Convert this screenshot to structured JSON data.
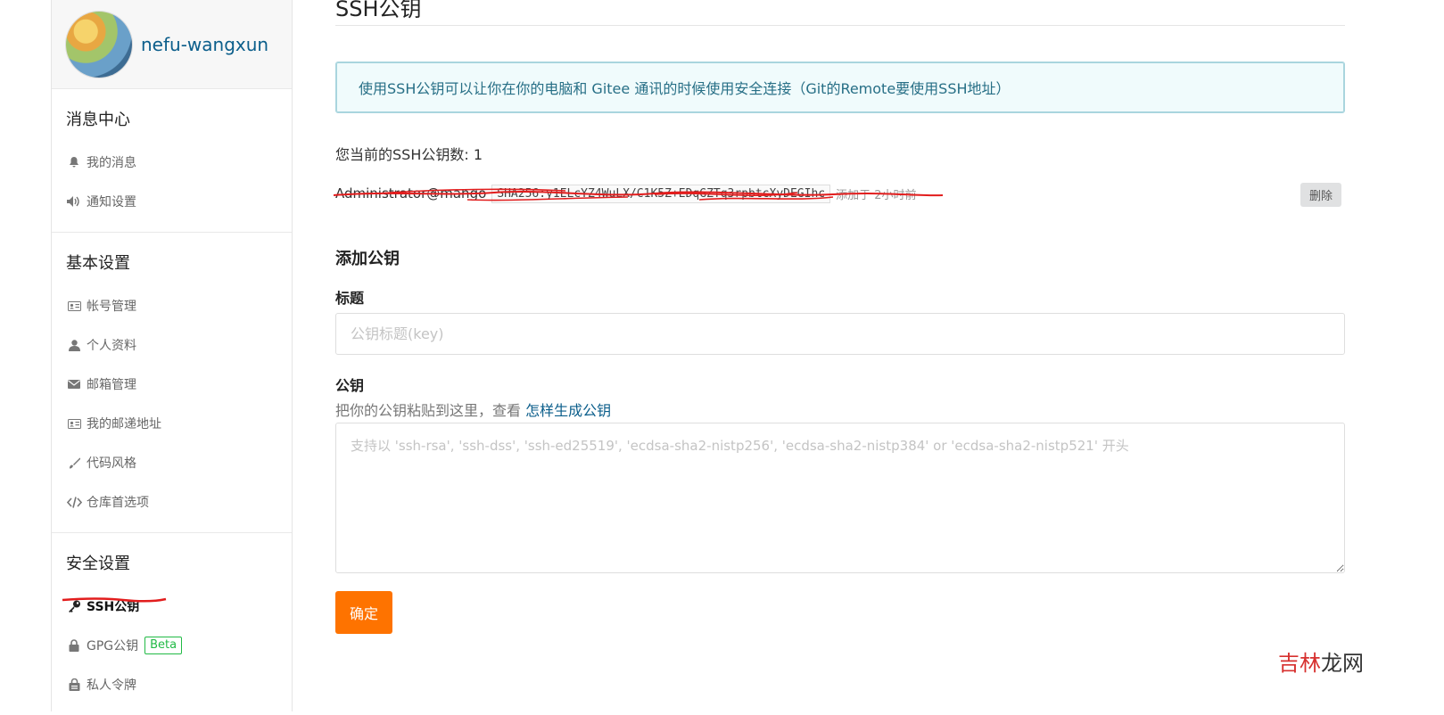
{
  "sidebar": {
    "username": "nefu-wangxun",
    "sections": [
      {
        "title": "消息中心",
        "items": [
          {
            "label": "我的消息"
          },
          {
            "label": "通知设置"
          }
        ]
      },
      {
        "title": "基本设置",
        "items": [
          {
            "label": "帐号管理"
          },
          {
            "label": "个人资料"
          },
          {
            "label": "邮箱管理"
          },
          {
            "label": "我的邮递地址"
          },
          {
            "label": "代码风格"
          },
          {
            "label": "仓库首选项"
          }
        ]
      },
      {
        "title": "安全设置",
        "items": [
          {
            "label": "SSH公钥"
          },
          {
            "label": "GPG公钥",
            "badge": "Beta"
          },
          {
            "label": "私人令牌"
          }
        ]
      }
    ]
  },
  "main": {
    "title": "SSH公钥",
    "info": "使用SSH公钥可以让你在你的电脑和 Gitee 通讯的时候使用安全连接（Git的Remote要使用SSH地址）",
    "count_text": "您当前的SSH公钥数: 1",
    "key": {
      "title": "Administrator@mango",
      "fingerprint": "SHA256:y1ELcYZ4WuLX/C1K5Z+EDqGZTq3rpbtcXyDEGIhc",
      "time": "添加于 2小时前",
      "delete_label": "删除"
    },
    "add_title": "添加公钥",
    "title_label": "标题",
    "title_placeholder": "公钥标题(key)",
    "key_label": "公钥",
    "hint_prefix": "把你的公钥粘贴到这里，查看 ",
    "hint_link": "怎样生成公钥",
    "key_placeholder": "支持以 'ssh-rsa', 'ssh-dss', 'ssh-ed25519', 'ecdsa-sha2-nistp256', 'ecdsa-sha2-nistp384' or 'ecdsa-sha2-nistp521' 开头",
    "submit_label": "确定"
  },
  "watermark": {
    "part1": "吉林",
    "part2": "龙网"
  },
  "colors": {
    "accent": "#fe7300",
    "link": "#0b5e8b",
    "info_bg": "#f0fbfc",
    "beta": "#21ba45",
    "mark_red": "#e21d1d"
  }
}
